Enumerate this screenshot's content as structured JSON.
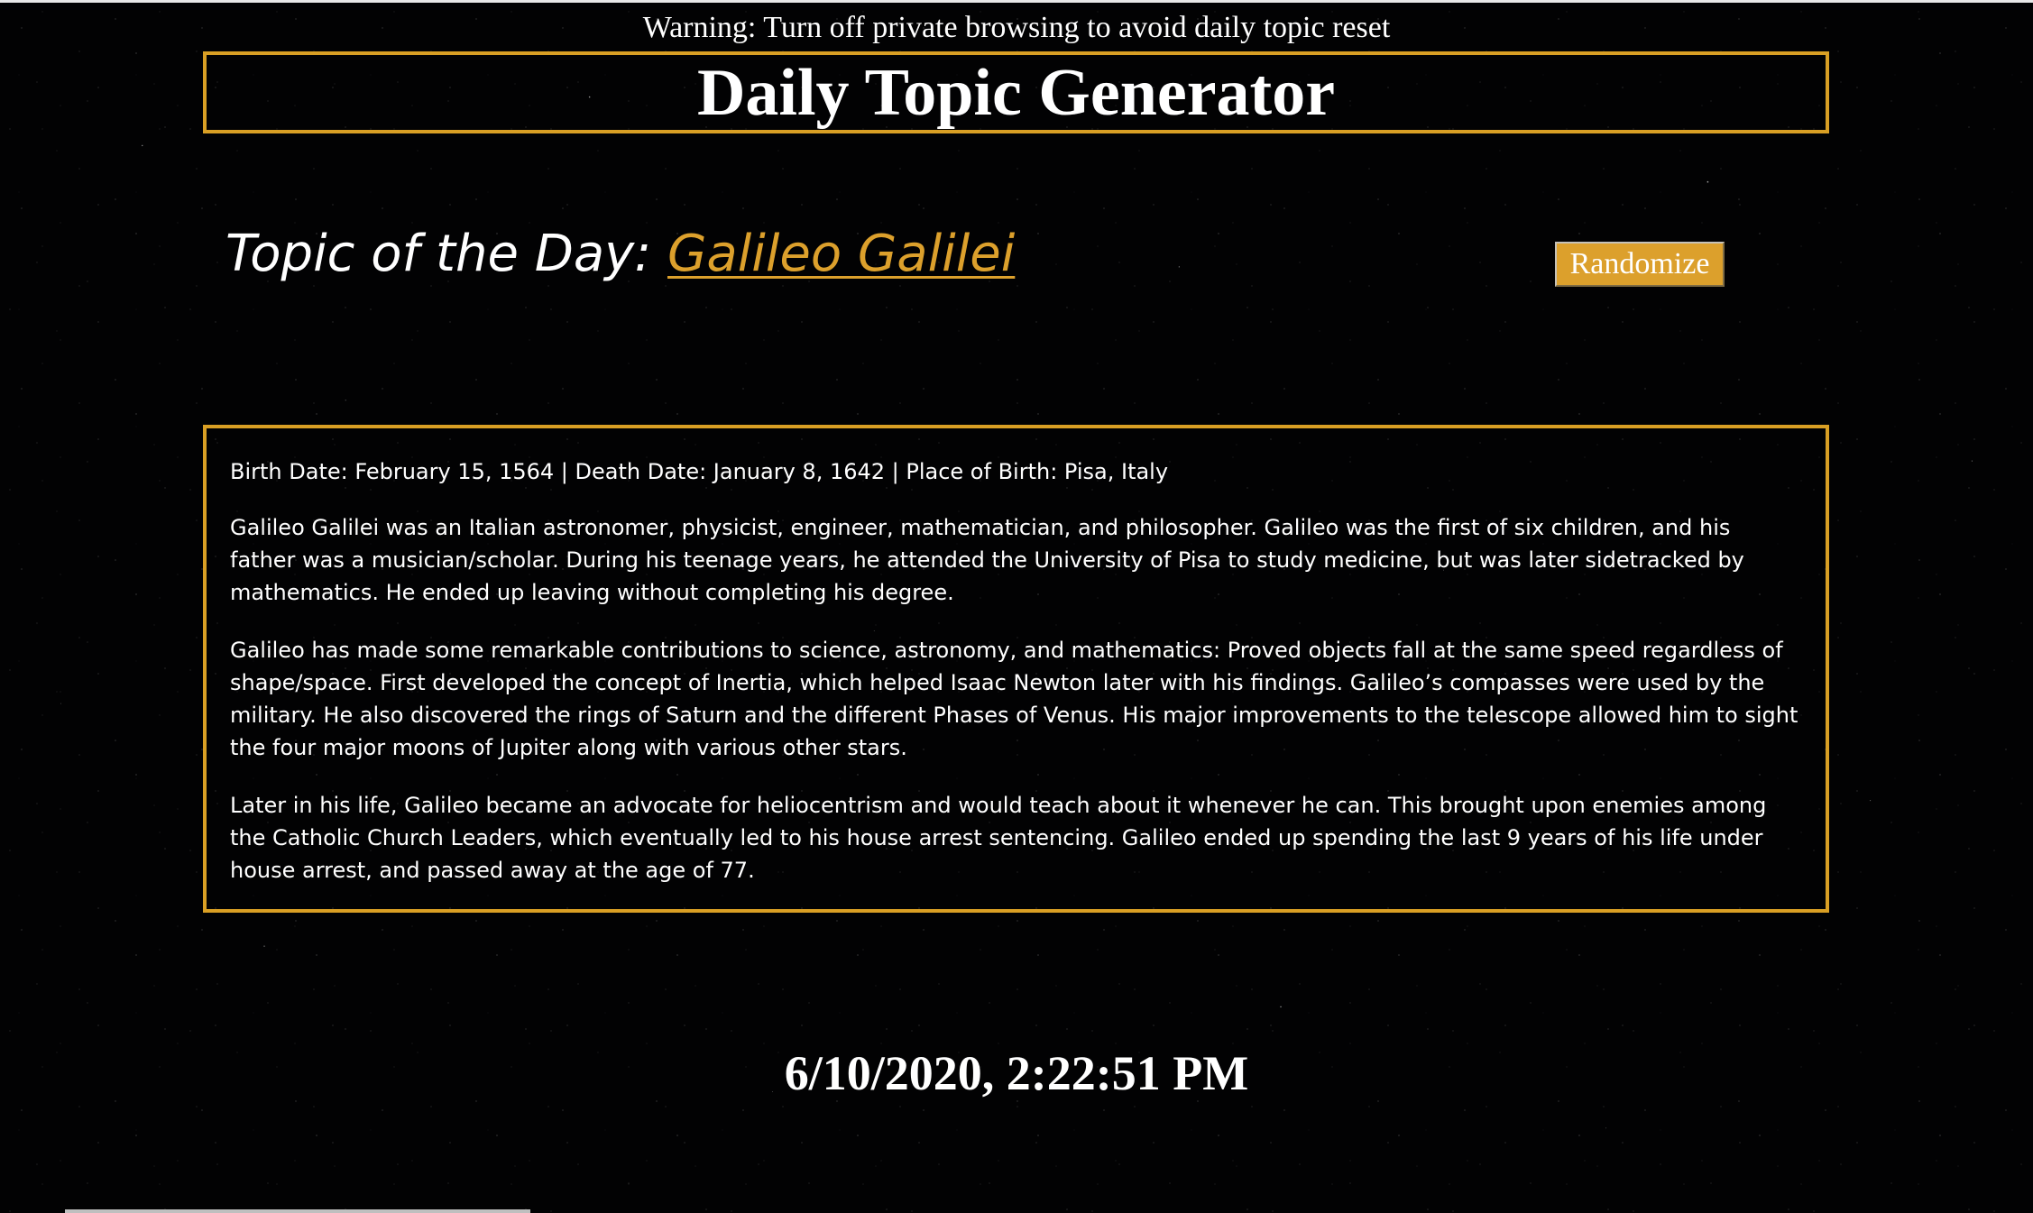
{
  "warning": "Warning: Turn off private browsing to avoid daily topic reset",
  "header": {
    "title": "Daily Topic Generator"
  },
  "topic": {
    "prefix": "Topic of the Day: ",
    "name": "Galileo Galilei"
  },
  "randomize_label": "Randomize",
  "info": {
    "meta": "Birth Date: February 15, 1564 | Death Date: January 8, 1642 | Place of Birth: Pisa, Italy",
    "paragraphs": [
      "Galileo Galilei was an Italian astronomer, physicist, engineer, mathematician, and philosopher. Galileo was the first of six children, and his father was a musician/scholar. During his teenage years, he attended the University of Pisa to study medicine, but was later sidetracked by mathematics. He ended up leaving without completing his degree.",
      "Galileo has made some remarkable contributions to science, astronomy, and mathematics: Proved objects fall at the same speed regardless of shape/space. First developed the concept of Inertia, which helped Isaac Newton later with his findings. Galileo’s compasses were used by the military. He also discovered the rings of Saturn and the different Phases of Venus. His major improvements to the telescope allowed him to sight the four major moons of Jupiter along with various other stars.",
      "Later in his life, Galileo became an advocate for heliocentrism and would teach about it whenever he can. This brought upon enemies among the Catholic Church Leaders, which eventually led to his house arrest sentencing. Galileo ended up spending the last 9 years of his life under house arrest, and passed away at the age of 77."
    ]
  },
  "datetime": "6/10/2020, 2:22:51 PM",
  "colors": {
    "accent": "#d99f24",
    "link": "#dca02c",
    "background": "#020203",
    "text": "#ffffff"
  }
}
